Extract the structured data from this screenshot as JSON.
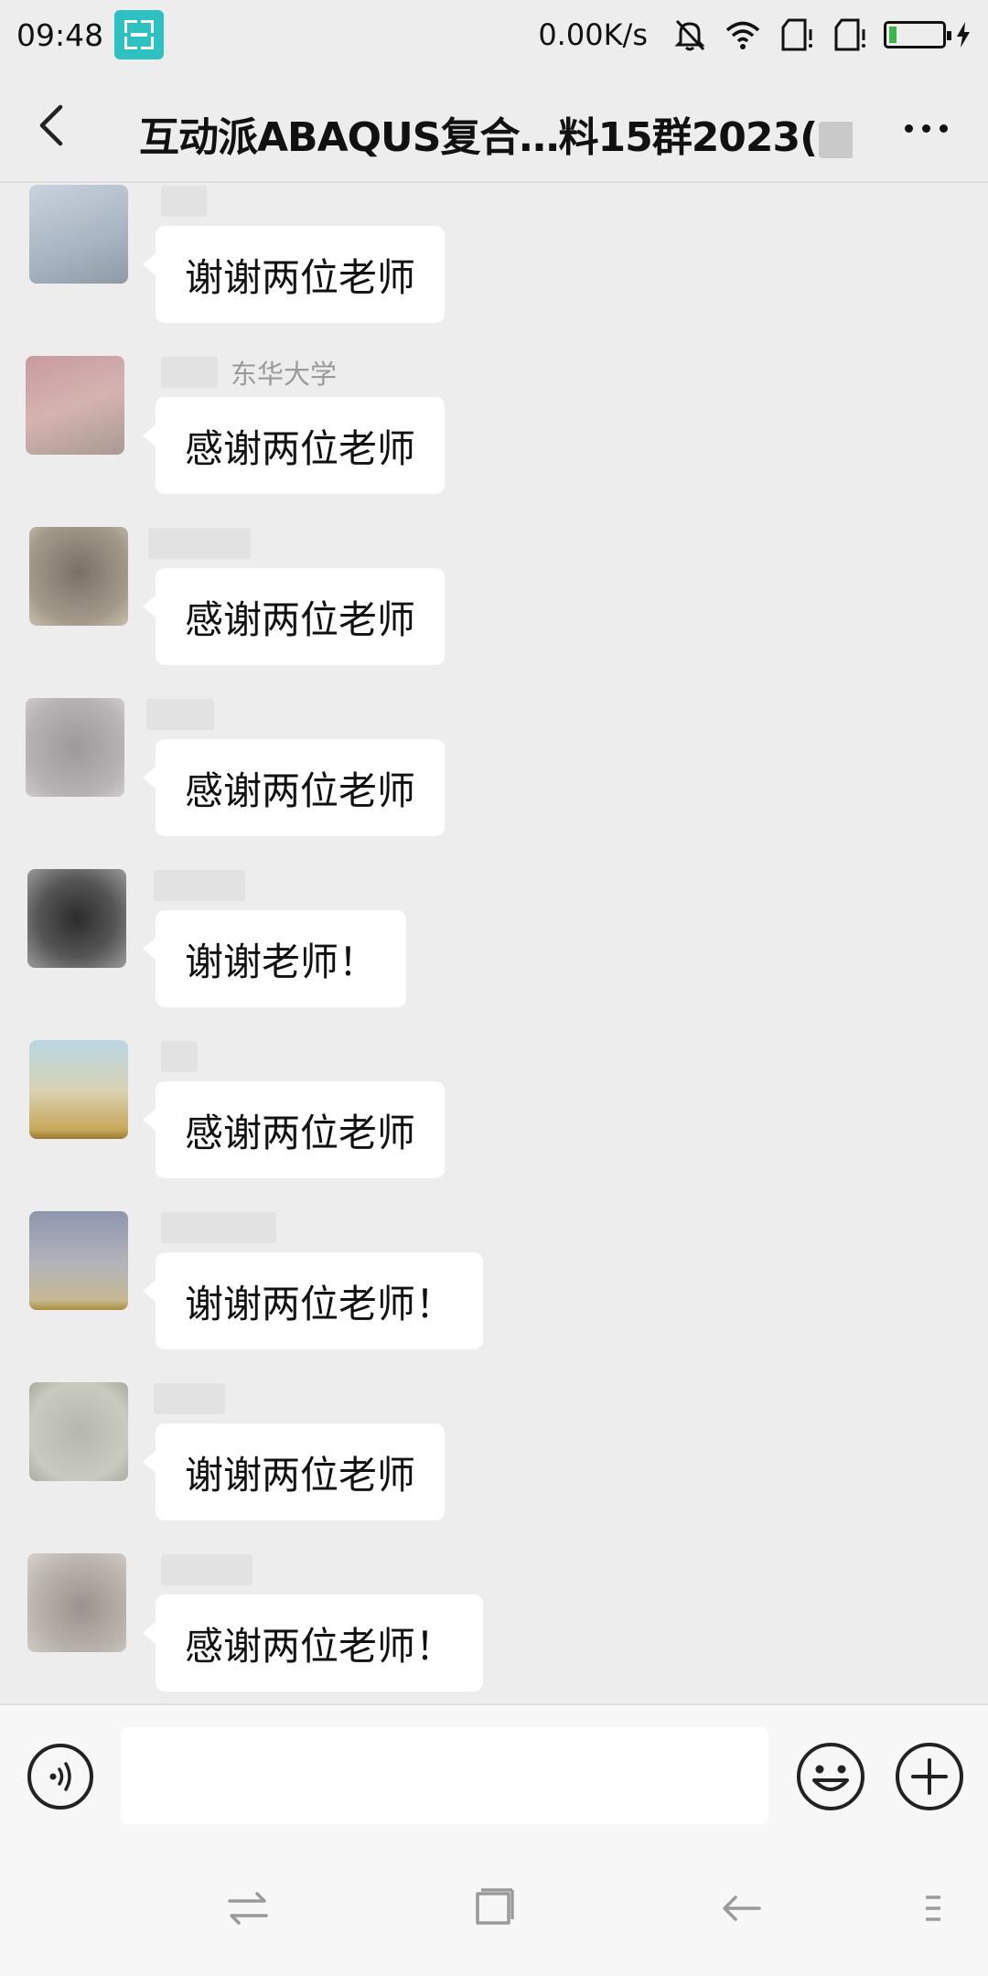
{
  "status_bar": {
    "time": "09:48",
    "network_speed": "0.00K/s",
    "icons": [
      "screenshot-scan-icon",
      "bell-muted-icon",
      "wifi-icon",
      "sim-card-icon",
      "sim-card-icon",
      "battery-charging-icon"
    ]
  },
  "header": {
    "title_part1": "互动派ABAQUS复合…料15群2023(",
    "title_part2": ")",
    "back_icon": "chevron-left-icon",
    "more_icon": "more-dots-icon"
  },
  "messages": [
    {
      "sender_name": "",
      "sender_suffix": "",
      "text": "谢谢两位老师"
    },
    {
      "sender_name": "",
      "sender_suffix": "东华大学",
      "text": "感谢两位老师"
    },
    {
      "sender_name": "",
      "sender_suffix": "",
      "text": "感谢两位老师"
    },
    {
      "sender_name": "",
      "sender_suffix": "",
      "text": "感谢两位老师"
    },
    {
      "sender_name": "",
      "sender_suffix": "",
      "text": "谢谢老师！"
    },
    {
      "sender_name": "",
      "sender_suffix": "",
      "text": "感谢两位老师"
    },
    {
      "sender_name": "",
      "sender_suffix": "",
      "text": "谢谢两位老师！"
    },
    {
      "sender_name": "",
      "sender_suffix": "",
      "text": "谢谢两位老师"
    },
    {
      "sender_name": "",
      "sender_suffix": "",
      "text": "感谢两位老师！"
    }
  ],
  "input_bar": {
    "voice_icon": "voice-input-icon",
    "placeholder": "",
    "emoji_icon": "emoji-icon",
    "plus_icon": "plus-circle-icon"
  },
  "nav_bar": {
    "icons": [
      "switch-apps-icon",
      "home-square-icon",
      "back-arrow-icon",
      "menu-icon"
    ]
  },
  "colors": {
    "background": "#ededed",
    "bubble": "#ffffff",
    "accent_status": "#2ec1c1",
    "battery_fill": "#3bb54a"
  }
}
